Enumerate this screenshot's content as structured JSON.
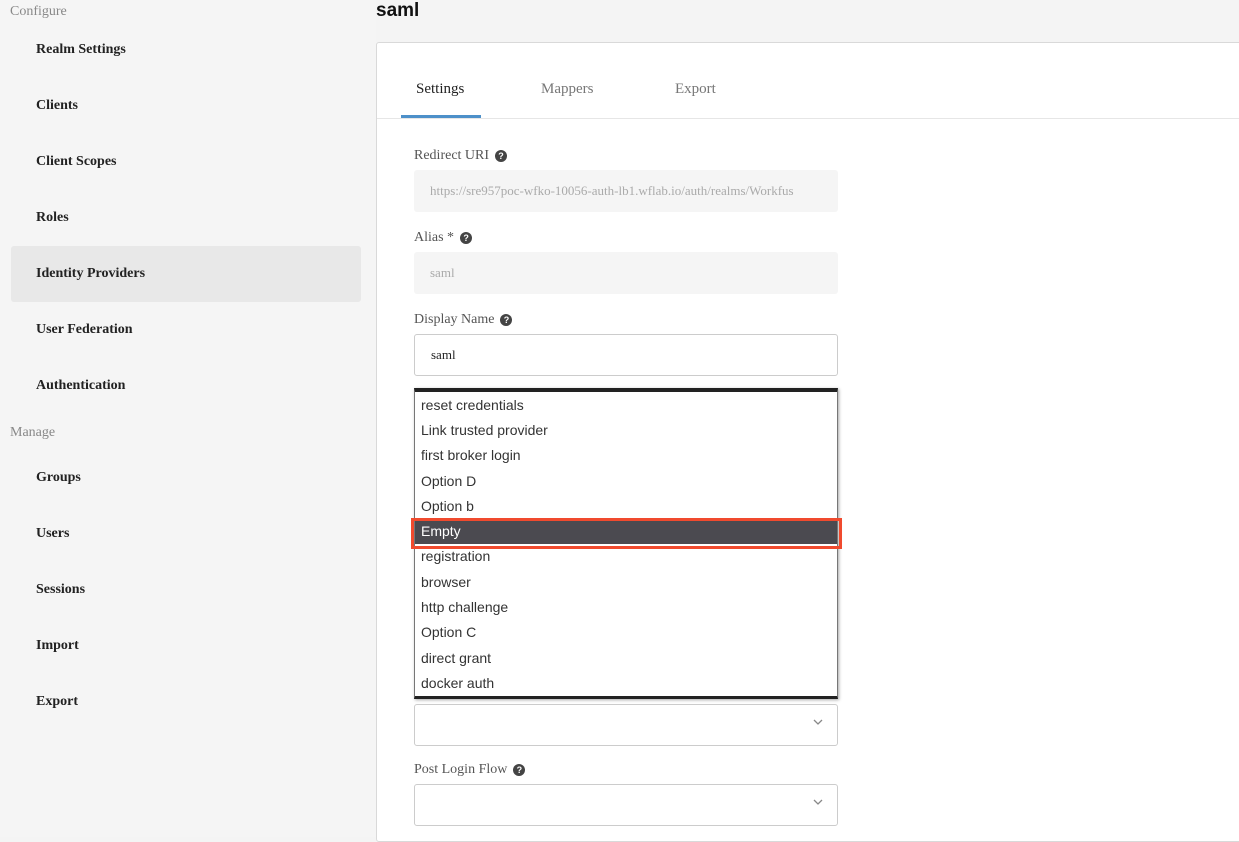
{
  "sidebar": {
    "configure_label": "Configure",
    "configure_items": [
      {
        "label": "Realm Settings"
      },
      {
        "label": "Clients"
      },
      {
        "label": "Client Scopes"
      },
      {
        "label": "Roles"
      },
      {
        "label": "Identity Providers",
        "active": true
      },
      {
        "label": "User Federation"
      },
      {
        "label": "Authentication"
      }
    ],
    "manage_label": "Manage",
    "manage_items": [
      {
        "label": "Groups"
      },
      {
        "label": "Users"
      },
      {
        "label": "Sessions"
      },
      {
        "label": "Import"
      },
      {
        "label": "Export"
      }
    ]
  },
  "page": {
    "title": "saml"
  },
  "tabs": [
    {
      "label": "Settings",
      "active": true
    },
    {
      "label": "Mappers"
    },
    {
      "label": "Export"
    }
  ],
  "form": {
    "redirect_uri": {
      "label": "Redirect URI",
      "value": "https://sre957poc-wfko-10056-auth-lb1.wflab.io/auth/realms/Workfus"
    },
    "alias": {
      "label": "Alias *",
      "value": "saml"
    },
    "display_name": {
      "label": "Display Name",
      "value": "saml"
    },
    "post_login_flow": {
      "label": "Post Login Flow",
      "value": ""
    }
  },
  "dropdown": {
    "options": [
      "reset credentials",
      "Link trusted provider",
      "first broker login",
      "Option D",
      "Option b",
      "Empty",
      "registration",
      "browser",
      "http challenge",
      "Option C",
      "direct grant",
      "docker auth"
    ],
    "highlighted": "Empty"
  }
}
